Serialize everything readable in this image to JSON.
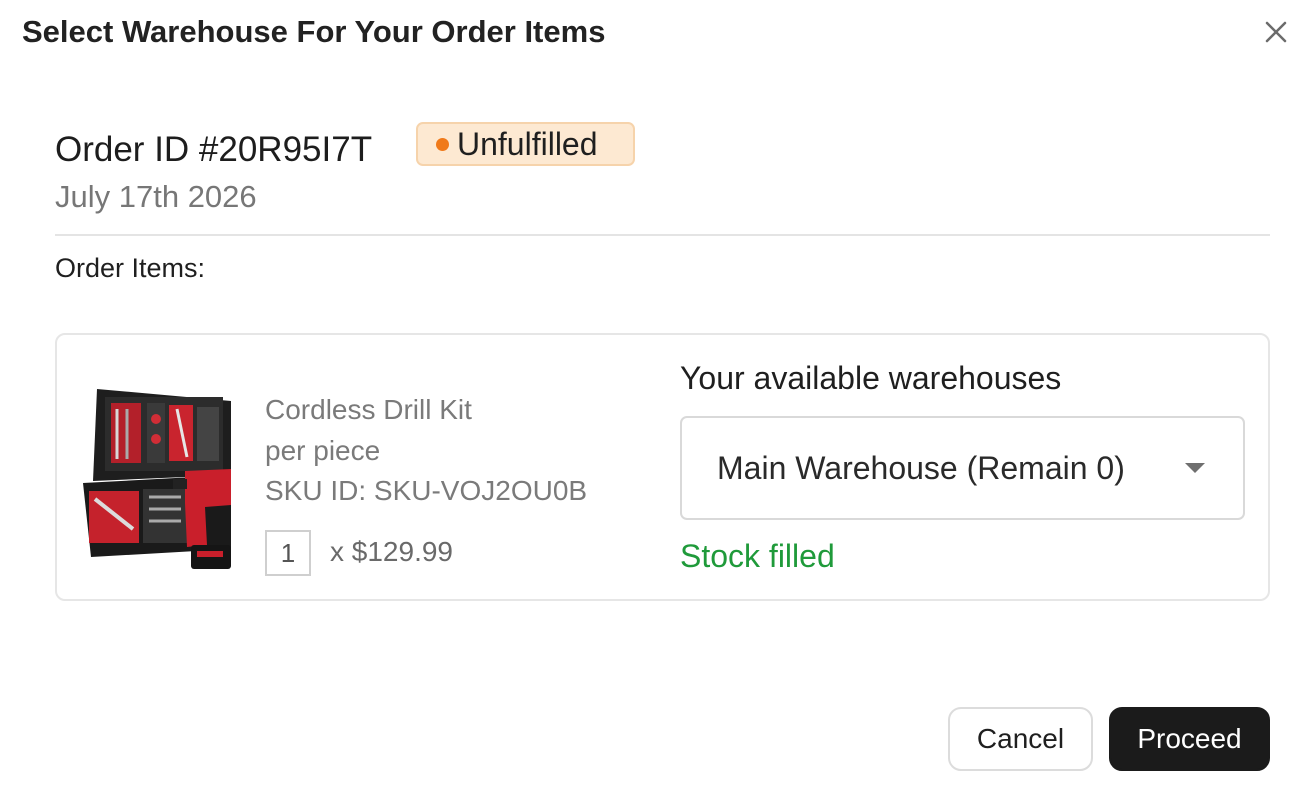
{
  "modal": {
    "title": "Select Warehouse For Your Order Items",
    "close_icon": "close-icon"
  },
  "order": {
    "id_label": "Order ID #20R95I7T",
    "status": "Unfulfilled",
    "status_color": "#f07a1a",
    "date": "July 17th 2026",
    "items_label": "Order Items:"
  },
  "items": [
    {
      "image_icon": "drill-kit-image",
      "name": "Cordless Drill Kit",
      "unit": "per piece",
      "sku": "SKU ID: SKU-VOJ2OU0B",
      "quantity": "1",
      "price": "x $129.99",
      "warehouse_label": "Your available warehouses",
      "warehouse_selected": "Main Warehouse (Remain 0)",
      "stock_status": "Stock filled",
      "stock_status_color": "#1f9a3a"
    }
  ],
  "footer": {
    "cancel_label": "Cancel",
    "proceed_label": "Proceed"
  }
}
